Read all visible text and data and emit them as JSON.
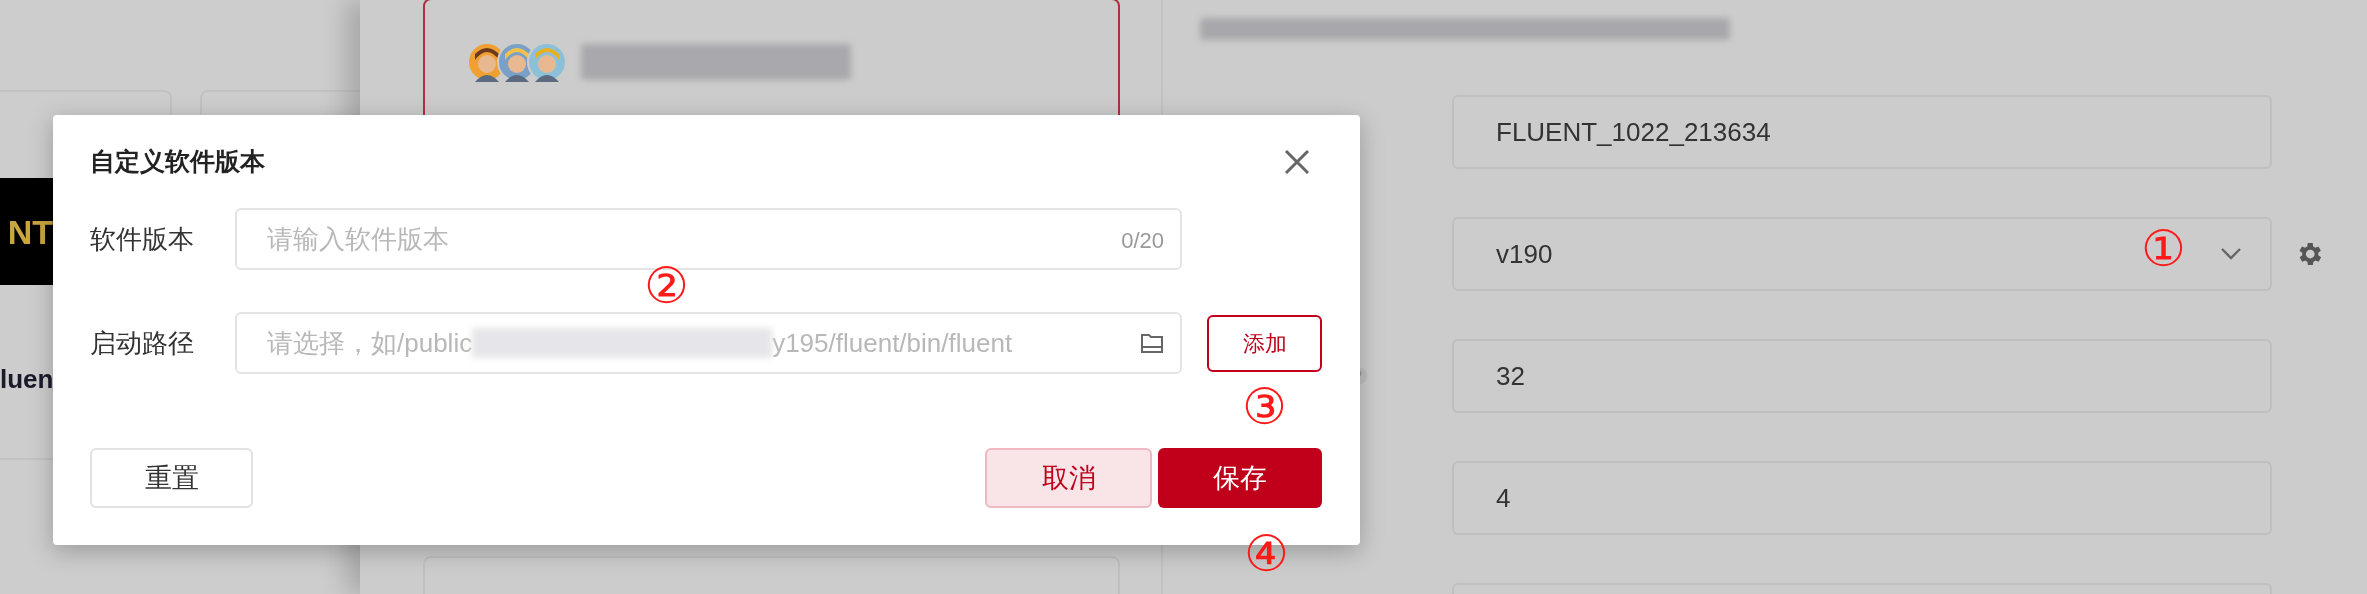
{
  "background": {
    "logo_text": "NT",
    "card_title": "luen"
  },
  "drawer": {
    "fields": [
      {
        "kind": "input",
        "value": "FLUENT_1022_213634"
      },
      {
        "kind": "select",
        "value": "v190"
      },
      {
        "kind": "input",
        "value": "32",
        "help": true
      },
      {
        "kind": "input",
        "value": "4"
      },
      {
        "kind": "input"
      }
    ]
  },
  "dialog": {
    "title": "自定义软件版本",
    "fields": [
      {
        "kind": "text",
        "label": "软件版本",
        "placeholder": "请输入软件版本",
        "counter": "0/20"
      },
      {
        "kind": "path",
        "label": "启动路径",
        "placeholder_start": "请选择，如/public",
        "placeholder_end": "y195/fluent/bin/fluent",
        "add_button": "添加"
      }
    ],
    "buttons": [
      {
        "kind": "reset",
        "label": "重置"
      },
      {
        "kind": "cancel",
        "label": "取消"
      },
      {
        "kind": "primary",
        "label": "保存"
      }
    ]
  },
  "annotations": [
    "①",
    "②",
    "③",
    "④"
  ]
}
